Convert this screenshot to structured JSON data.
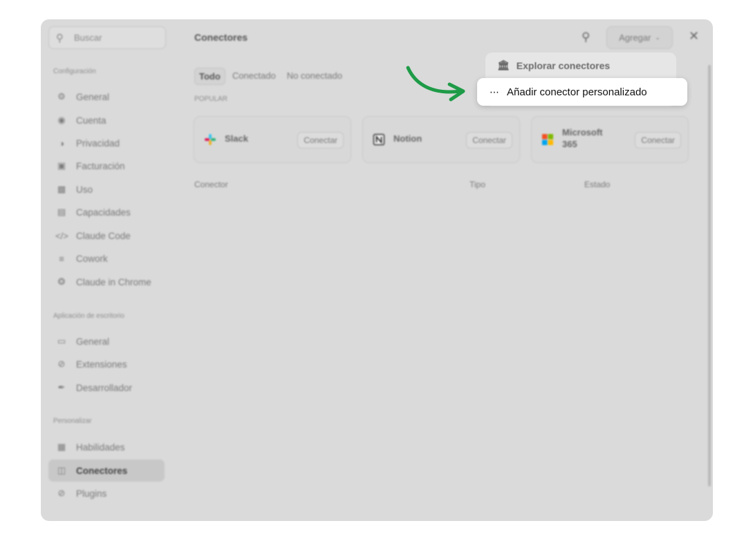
{
  "sidebar": {
    "search_placeholder": "Buscar",
    "sections": [
      {
        "title": "Configuración",
        "items": [
          {
            "label": "General",
            "icon": "gear-icon"
          },
          {
            "label": "Cuenta",
            "icon": "account-icon"
          },
          {
            "label": "Privacidad",
            "icon": "shield-icon"
          },
          {
            "label": "Facturación",
            "icon": "billing-icon"
          },
          {
            "label": "Uso",
            "icon": "bar-chart-icon"
          },
          {
            "label": "Capacidades",
            "icon": "briefcase-icon"
          },
          {
            "label": "Claude Code",
            "icon": "code-icon"
          },
          {
            "label": "Cowork",
            "icon": "list-icon"
          },
          {
            "label": "Claude in Chrome",
            "icon": "chrome-icon"
          }
        ]
      },
      {
        "title": "Aplicación de escritorio",
        "items": [
          {
            "label": "General",
            "icon": "monitor-icon"
          },
          {
            "label": "Extensiones",
            "icon": "plug-icon"
          },
          {
            "label": "Desarrollador",
            "icon": "wrench-icon"
          }
        ]
      },
      {
        "title": "Personalizar",
        "items": [
          {
            "label": "Habilidades",
            "icon": "skills-icon"
          },
          {
            "label": "Conectores",
            "icon": "connectors-icon",
            "active": true
          },
          {
            "label": "Plugins",
            "icon": "plug-icon"
          }
        ]
      }
    ]
  },
  "header": {
    "title": "Conectores",
    "add_button": "Agregar"
  },
  "tabs": [
    "Todo",
    "Conectado",
    "No conectado"
  ],
  "popular_label": "POPULAR",
  "cards": [
    {
      "name": "Slack",
      "button": "Conectar"
    },
    {
      "name": "Notion",
      "button": "Conectar"
    },
    {
      "name": "Microsoft 365",
      "name_line1": "Microsoft",
      "name_line2": "365",
      "button": "Conectar"
    }
  ],
  "table_headers": {
    "connector": "Conector",
    "type": "Tipo",
    "status": "Estado"
  },
  "dropdown": {
    "explore": "Explorar conectores",
    "custom": "Añadir conector personalizado"
  },
  "colors": {
    "arrow": "#1e9b47",
    "overlay": "#dadada",
    "highlight_bg": "#ffffff"
  }
}
